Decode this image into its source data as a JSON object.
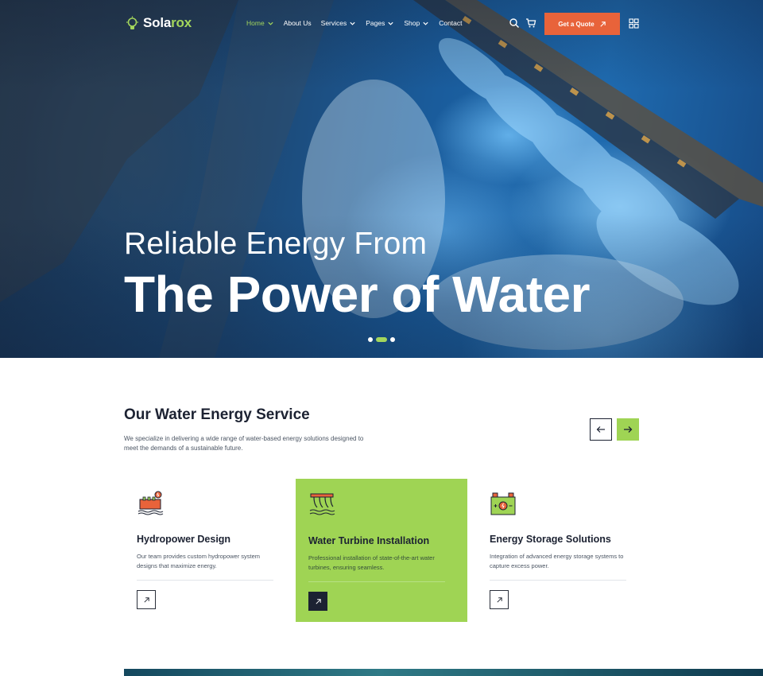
{
  "brand": {
    "name_main": "Sola",
    "name_accent": "rox",
    "logo_icon": "lightbulb-icon",
    "accent_color": "#a3d65c"
  },
  "nav": {
    "items": [
      {
        "label": "Home",
        "has_dropdown": true,
        "active": true
      },
      {
        "label": "About Us",
        "has_dropdown": false
      },
      {
        "label": "Services",
        "has_dropdown": true
      },
      {
        "label": "Pages",
        "has_dropdown": true
      },
      {
        "label": "Shop",
        "has_dropdown": true
      },
      {
        "label": "Contact",
        "has_dropdown": false
      }
    ],
    "search_icon": "search-icon",
    "cart_icon": "cart-icon",
    "cta_label": "Get a Quote",
    "cta_color": "#e8633a",
    "grid_icon": "grid-icon"
  },
  "hero": {
    "line1": "Reliable Energy From",
    "line2": "The Power of Water",
    "slides": 3,
    "active_slide": 2
  },
  "services": {
    "title": "Our Water Energy Service",
    "description": "We specialize in delivering a wide range of water-based energy solutions designed to meet the demands of a sustainable future.",
    "prev_icon": "arrow-left-icon",
    "next_icon": "arrow-right-icon",
    "cards": [
      {
        "title": "Hydropower Design",
        "text": "Our team provides custom hydropower system designs that maximize energy.",
        "icon": "hydropower-icon",
        "highlighted": false
      },
      {
        "title": "Water Turbine Installation",
        "text": "Professional installation of state-of-the-art water turbines, ensuring seamless.",
        "icon": "turbine-icon",
        "highlighted": true
      },
      {
        "title": "Energy Storage Solutions",
        "text": "Integration of advanced energy storage systems to capture excess power.",
        "icon": "battery-icon",
        "highlighted": false
      }
    ]
  },
  "colors": {
    "highlight": "#9fd454",
    "dark": "#1c2232"
  }
}
